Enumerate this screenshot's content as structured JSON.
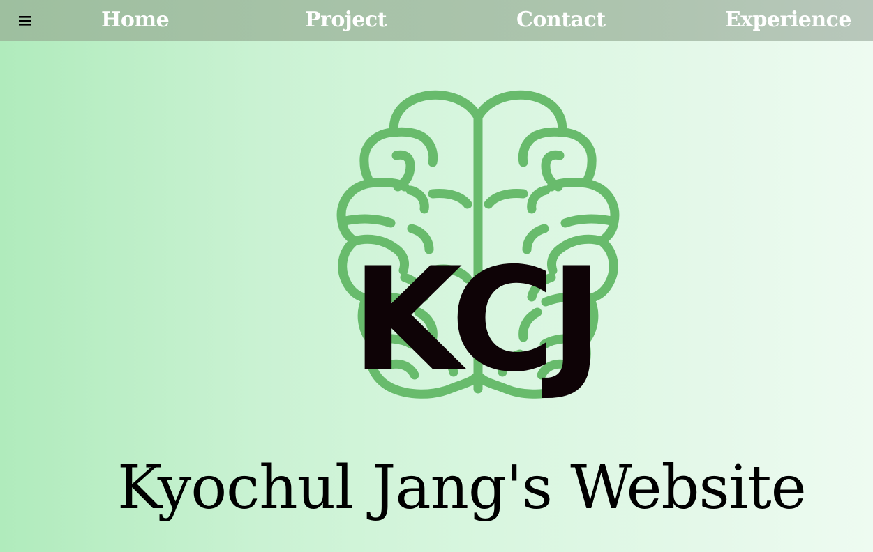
{
  "nav": {
    "menu_icon": "hamburger-menu-icon",
    "items": [
      {
        "label": "Home"
      },
      {
        "label": "Project"
      },
      {
        "label": "Contact"
      },
      {
        "label": "Experience"
      }
    ]
  },
  "logo": {
    "icon": "brain-icon",
    "text": "KCJ"
  },
  "hero": {
    "title": "Kyochul Jang's Website"
  },
  "colors": {
    "brain_green": "#68bb6c",
    "logo_text": "#0e0306",
    "nav_text": "#ffffff"
  }
}
